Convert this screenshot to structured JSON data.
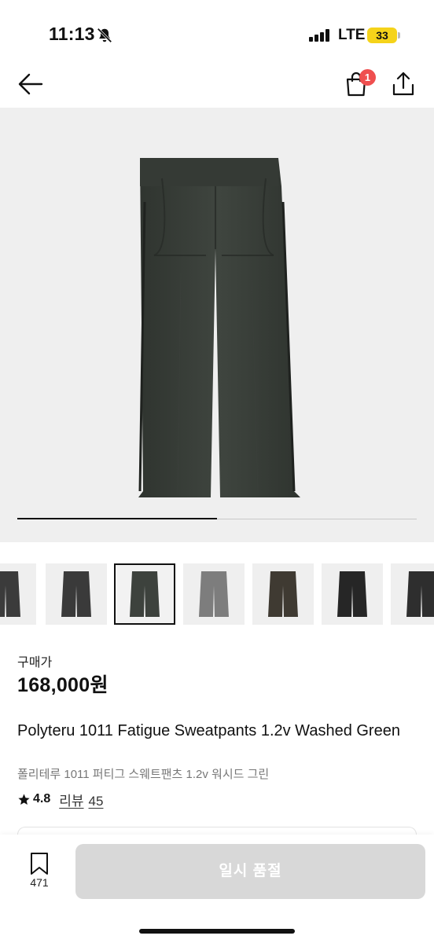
{
  "status_bar": {
    "time": "11:13",
    "network": "LTE",
    "battery": "33",
    "battery_color": "#f5d31a"
  },
  "nav": {
    "back_icon": "arrow-left-icon",
    "cart_icon": "shopping-bag-icon",
    "cart_badge": "1",
    "share_icon": "share-icon"
  },
  "gallery": {
    "main_image": "dark green wide sweatpants",
    "slide_progress": 0.5,
    "thumbnails": [
      {
        "color": "#3b3b3b",
        "selected": false
      },
      {
        "color": "#3a3a3a",
        "selected": false
      },
      {
        "color": "#3d423d",
        "selected": true
      },
      {
        "color": "#7d7d7d",
        "selected": false
      },
      {
        "color": "#3f3a32",
        "selected": false
      },
      {
        "color": "#262626",
        "selected": false
      },
      {
        "color": "#2e2e2e",
        "selected": false
      }
    ]
  },
  "product": {
    "price_label": "구매가",
    "price": "168,000원",
    "title_en": "Polyteru 1011 Fatigue Sweatpants 1.2v Washed Green",
    "title_ko": "폴리테루 1011 퍼티그 스웨트팬츠 1.2v 워시드 그린",
    "rating": "4.8",
    "review_label": "리뷰",
    "review_count": "45"
  },
  "bottom_bar": {
    "bookmark_count": "471",
    "action_label": "일시 품절"
  },
  "colors": {
    "badge": "#ef4f4f",
    "disabled_button": "#d8d8d8",
    "image_bg": "#efefef"
  }
}
